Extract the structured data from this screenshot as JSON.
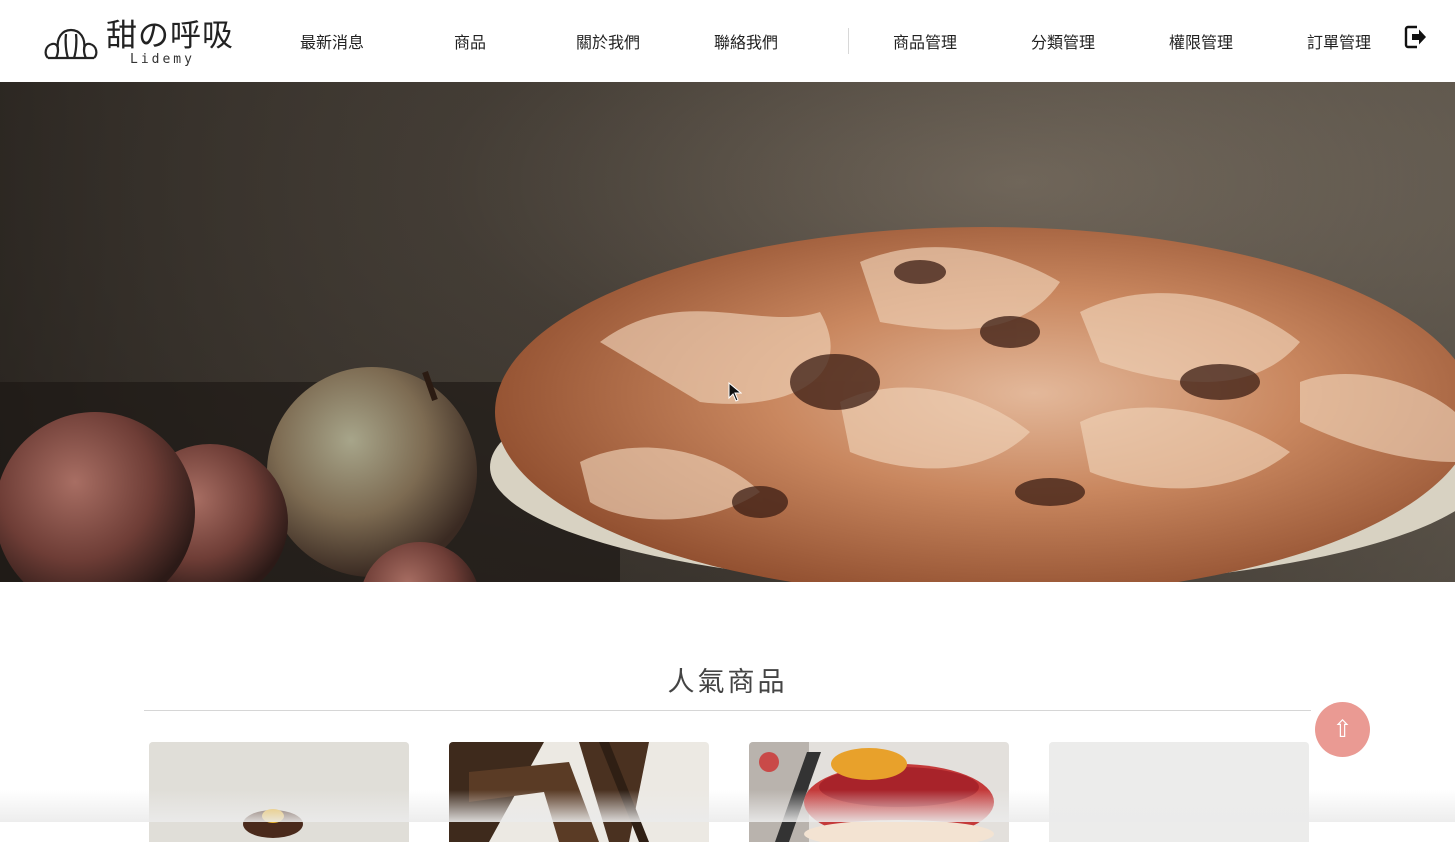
{
  "header": {
    "logo_title": "甜の呼吸",
    "logo_sub": "Lidemy",
    "nav": [
      {
        "label": "最新消息"
      },
      {
        "label": "商品"
      },
      {
        "label": "關於我們"
      },
      {
        "label": "聯絡我們"
      }
    ],
    "admin_nav": [
      {
        "label": "商品管理"
      },
      {
        "label": "分類管理"
      },
      {
        "label": "權限管理"
      },
      {
        "label": "訂單管理"
      }
    ],
    "logout_icon": "sign-out-icon"
  },
  "hero": {
    "image": "apple-pie-hero-photo"
  },
  "popular": {
    "title": "人氣商品",
    "cards": [
      {
        "image": "cake-photo"
      },
      {
        "image": "chair-table-photo"
      },
      {
        "image": "berry-tart-photo"
      },
      {
        "image": "light-plate-photo"
      }
    ]
  },
  "back_to_top": {
    "label": "⇧",
    "icon": "arrow-up-icon"
  },
  "colors": {
    "accent": "#ea9a93",
    "text": "#222222",
    "rule": "#d6d6d6"
  }
}
